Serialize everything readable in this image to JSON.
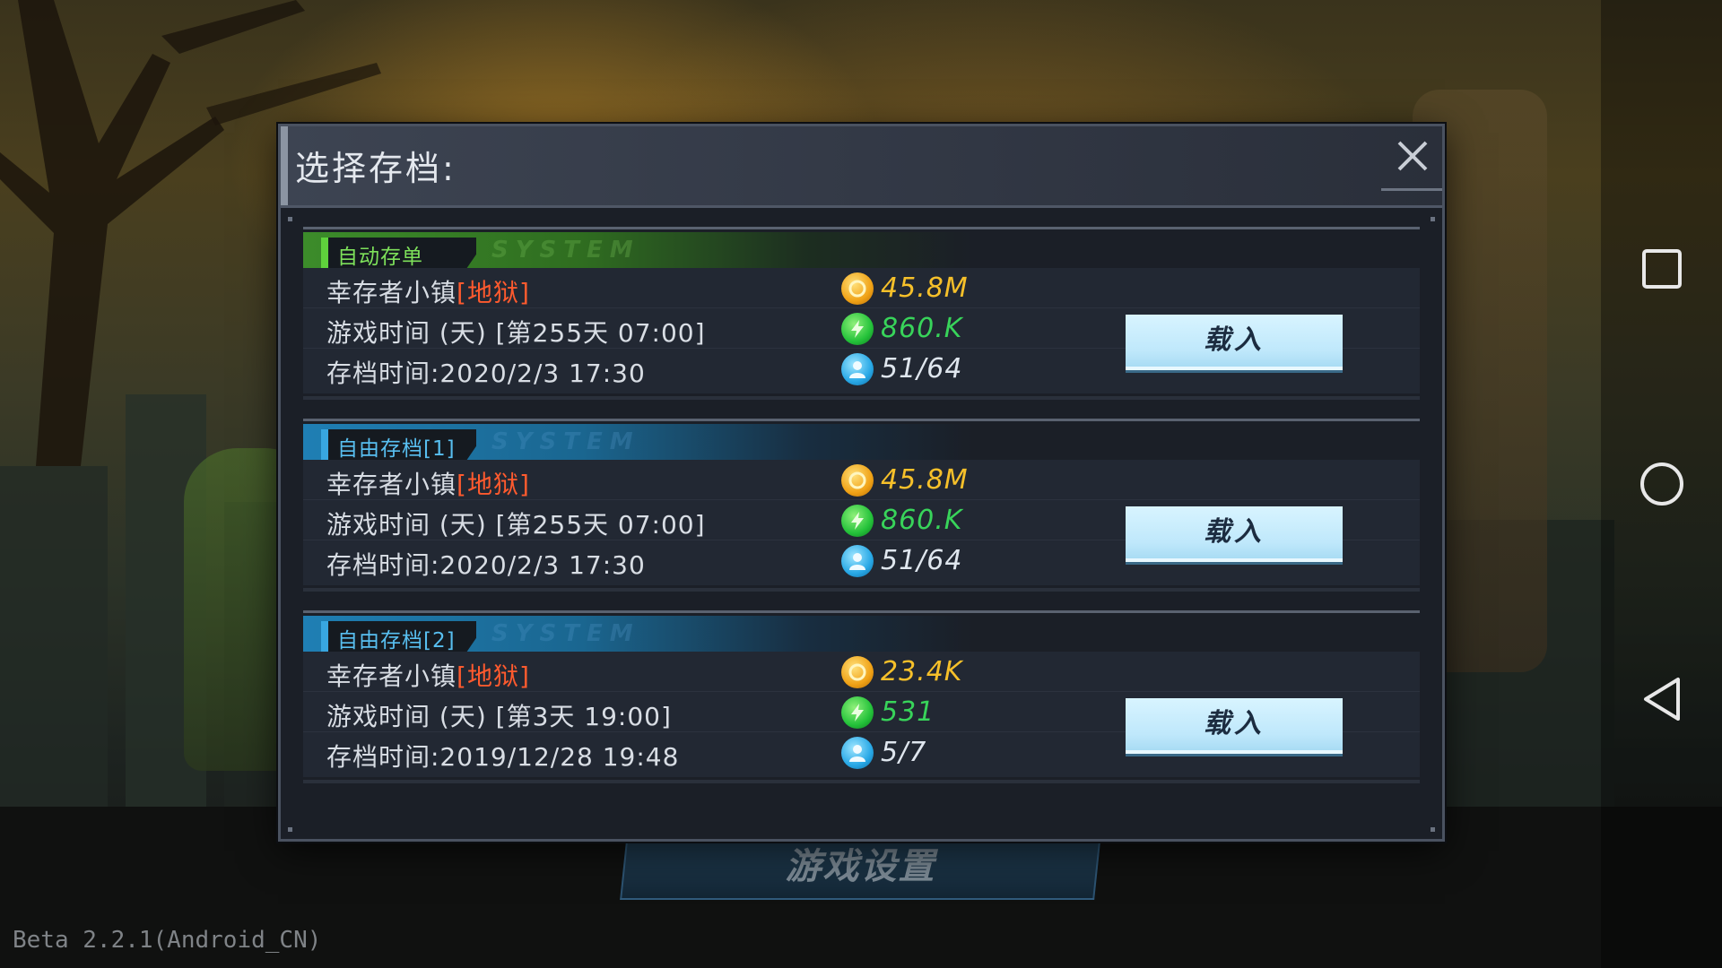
{
  "modal": {
    "title": "选择存档:",
    "close_icon": "close-icon"
  },
  "slots": [
    {
      "tag": "自动存单",
      "tag_color": "#5fd23c",
      "watermark": "SYSTEM",
      "location_prefix": "幸存者小镇",
      "location_difficulty": "[地狱]",
      "game_time": "游戏时间 (天) [第255天 07:00]",
      "save_time": "存档时间:2020/2/3  17:30",
      "coins": "45.8M",
      "energy": "860.K",
      "population": "51/64",
      "load_label": "载入"
    },
    {
      "tag": "自由存档[1]",
      "tag_color": "#38a6e0",
      "watermark": "SYSTEM",
      "location_prefix": "幸存者小镇",
      "location_difficulty": "[地狱]",
      "game_time": "游戏时间 (天) [第255天 07:00]",
      "save_time": "存档时间:2020/2/3  17:30",
      "coins": "45.8M",
      "energy": "860.K",
      "population": "51/64",
      "load_label": "载入"
    },
    {
      "tag": "自由存档[2]",
      "tag_color": "#38a6e0",
      "watermark": "SYSTEM",
      "location_prefix": "幸存者小镇",
      "location_difficulty": "[地狱]",
      "game_time": "游戏时间 (天) [第3天 19:00]",
      "save_time": "存档时间:2019/12/28  19:48",
      "coins": "23.4K",
      "energy": "531",
      "population": "5/7",
      "load_label": "载入"
    }
  ],
  "background": {
    "settings_button": "游戏设置",
    "version": "Beta 2.2.1(Android_CN)"
  },
  "icons": {
    "coin": "coin-icon",
    "energy": "energy-icon",
    "population": "population-icon",
    "nav_recents": "square-icon",
    "nav_home": "circle-icon",
    "nav_back": "triangle-back-icon"
  },
  "colors": {
    "difficulty": "#ff5a2e",
    "coins": "#f6c02a",
    "energy": "#38d45a",
    "load_button": "#bfe8fb"
  }
}
